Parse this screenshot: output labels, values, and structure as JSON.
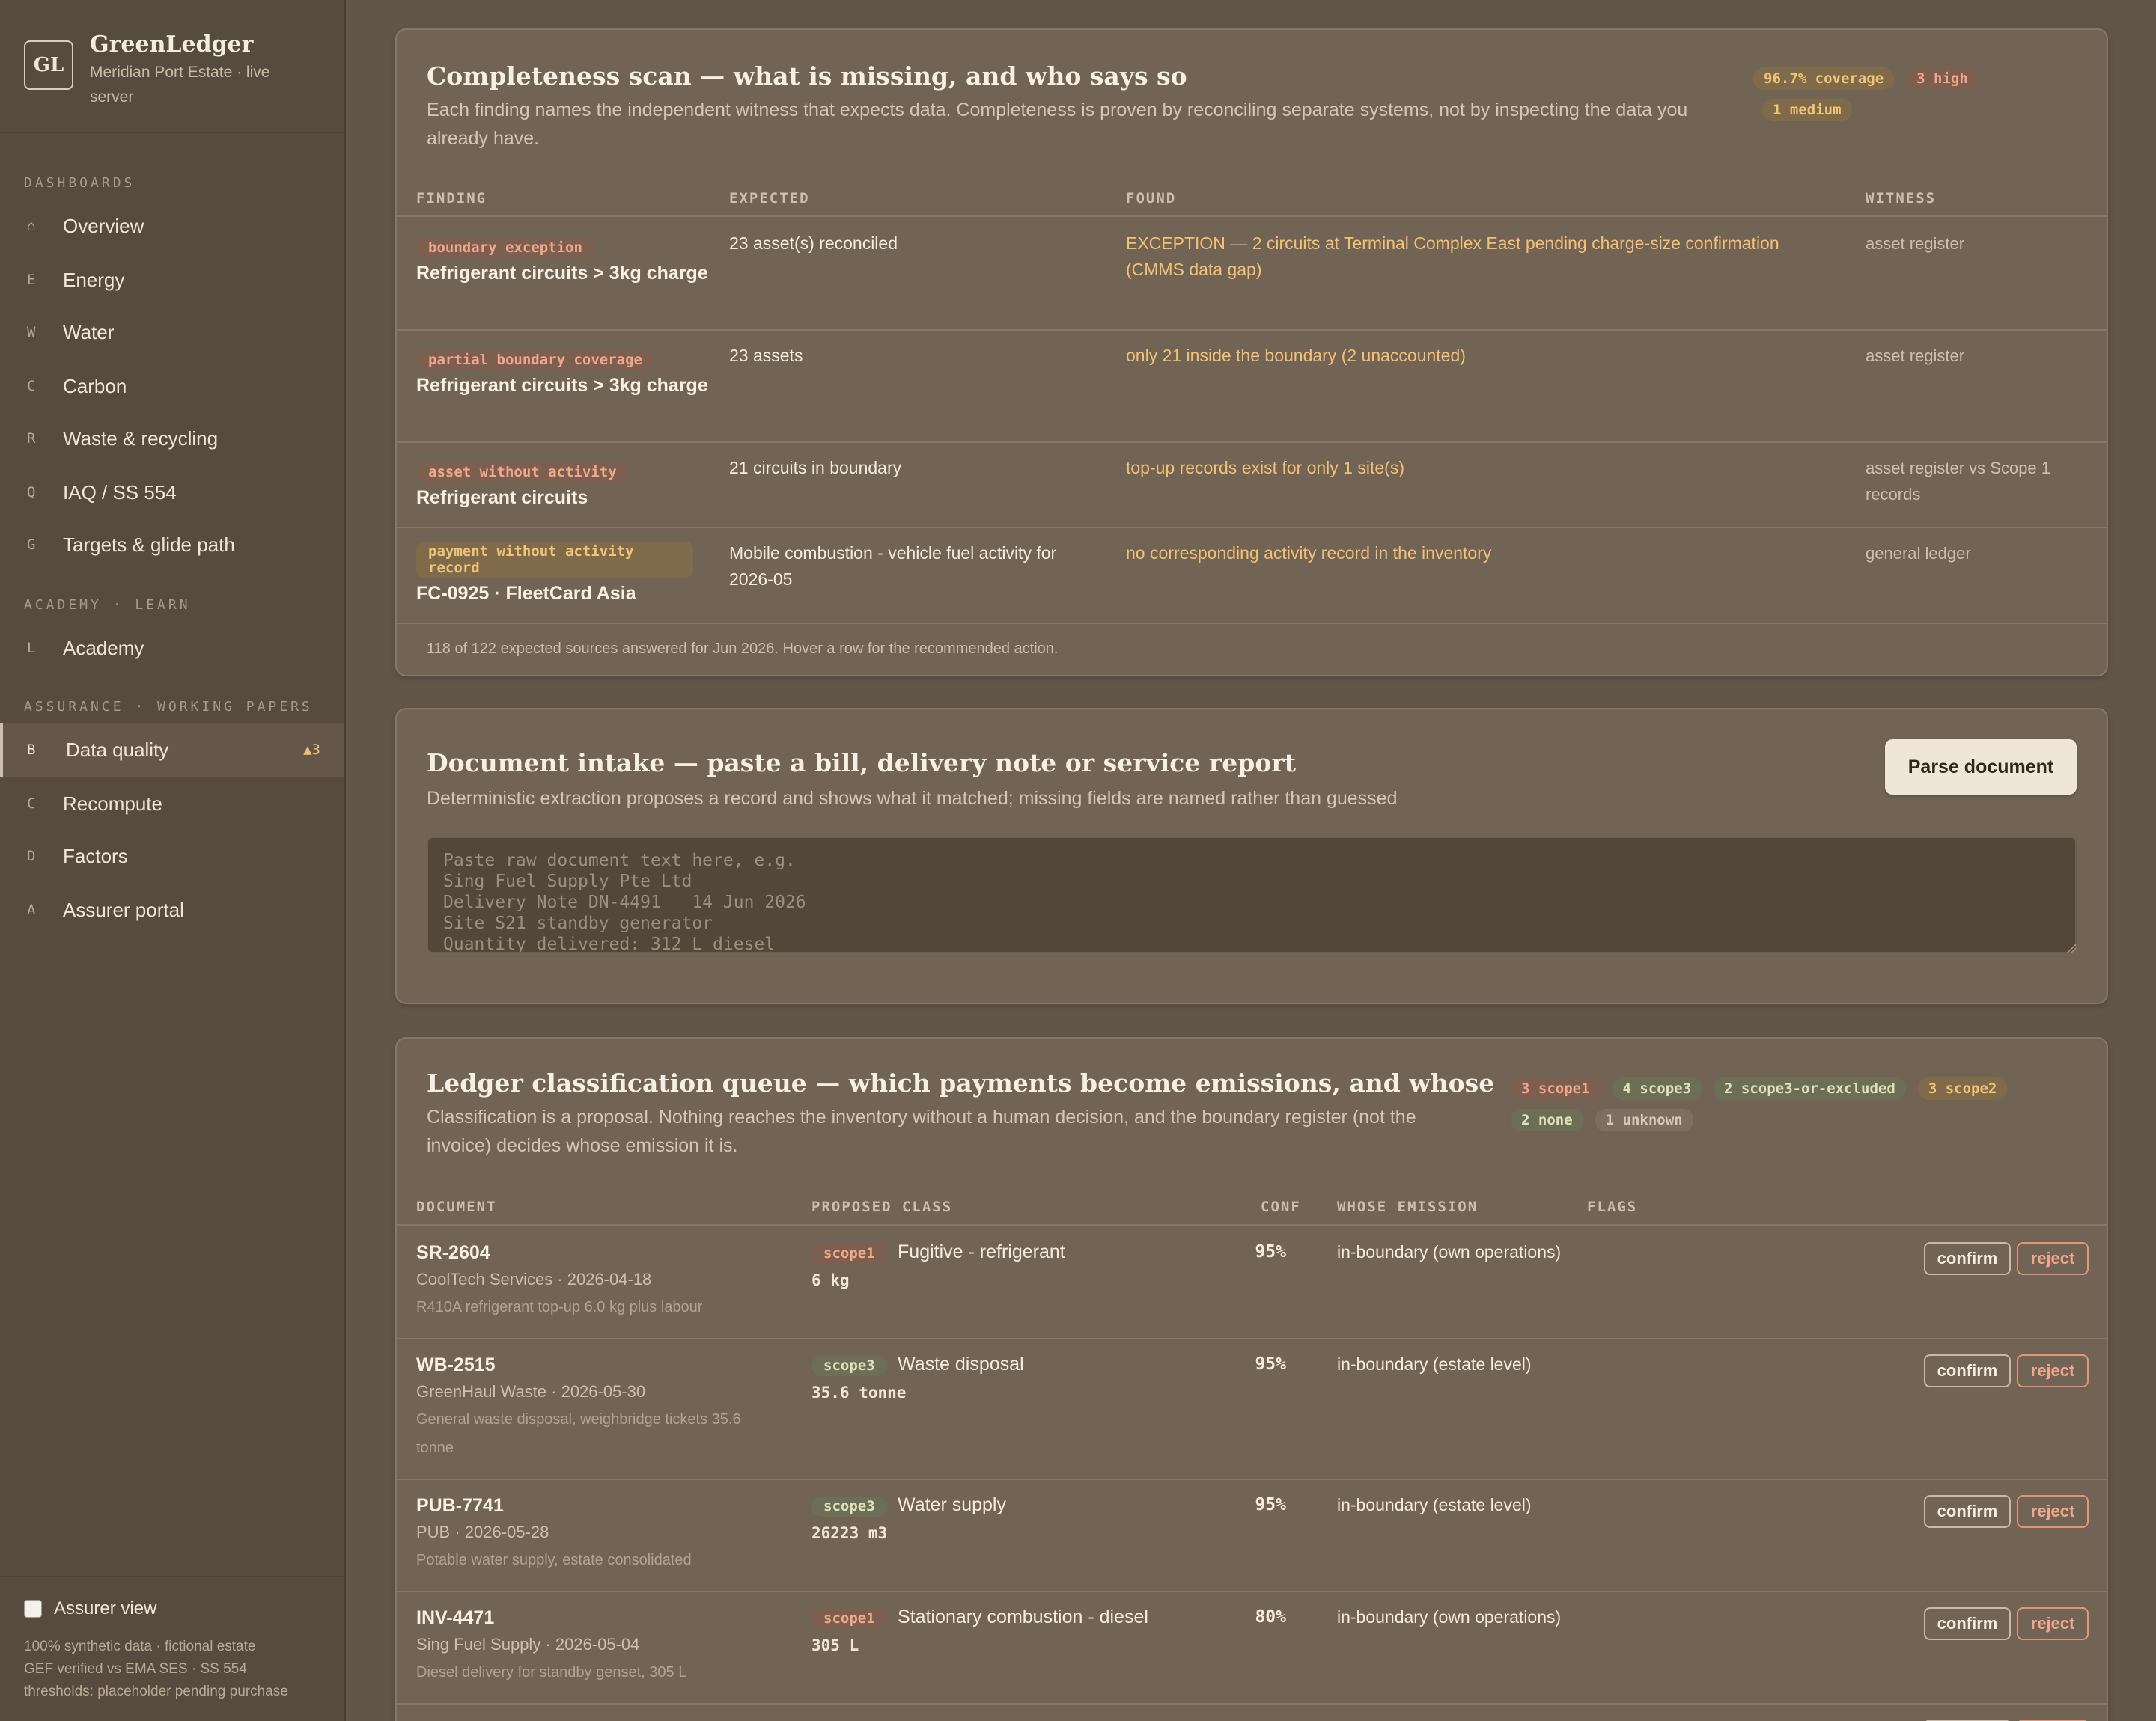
{
  "brand": {
    "logo": "GL",
    "name": "GreenLedger",
    "subtitle": "Meridian Port Estate · live server"
  },
  "sidebar": {
    "sections": [
      {
        "title": "DASHBOARDS",
        "items": [
          {
            "key": "⌂",
            "label": "Overview"
          },
          {
            "key": "E",
            "label": "Energy"
          },
          {
            "key": "W",
            "label": "Water"
          },
          {
            "key": "C",
            "label": "Carbon"
          },
          {
            "key": "R",
            "label": "Waste & recycling"
          },
          {
            "key": "Q",
            "label": "IAQ / SS 554"
          },
          {
            "key": "G",
            "label": "Targets & glide path"
          }
        ]
      },
      {
        "title": "ACADEMY · LEARN",
        "items": [
          {
            "key": "L",
            "label": "Academy"
          }
        ]
      },
      {
        "title": "ASSURANCE · WORKING PAPERS",
        "items": [
          {
            "key": "B",
            "label": "Data quality",
            "badge": "▲3",
            "active": true
          },
          {
            "key": "C",
            "label": "Recompute"
          },
          {
            "key": "D",
            "label": "Factors"
          },
          {
            "key": "A",
            "label": "Assurer portal"
          }
        ]
      }
    ],
    "assurer_label": "Assurer view",
    "footer_lines": [
      "100% synthetic data · fictional estate",
      "GEF verified vs EMA SES · SS 554",
      "thresholds: placeholder pending purchase"
    ]
  },
  "completeness": {
    "title": "Completeness scan — what is missing, and who says so",
    "description": "Each finding names the independent witness that expects data. Completeness is proven by reconciling separate systems, not by inspecting the data you already have.",
    "tags": [
      {
        "text": "96.7% coverage",
        "tone": "amber"
      },
      {
        "text": "3 high",
        "tone": "red"
      },
      {
        "text": "1 medium",
        "tone": "amber"
      }
    ],
    "columns": [
      "FINDING",
      "EXPECTED",
      "FOUND",
      "WITNESS"
    ],
    "rows": [
      {
        "tag": "boundary exception",
        "tone": "red",
        "subject": "Refrigerant circuits > 3kg charge",
        "expected": "23 asset(s) reconciled",
        "found": "EXCEPTION — 2 circuits at Terminal Complex East pending charge-size confirmation (CMMS data gap)",
        "witness": "asset register"
      },
      {
        "tag": "partial boundary coverage",
        "tone": "red",
        "subject": "Refrigerant circuits > 3kg charge",
        "expected": "23 assets",
        "found": "only 21 inside the boundary (2 unaccounted)",
        "witness": "asset register"
      },
      {
        "tag": "asset without activity",
        "tone": "red",
        "subject": "Refrigerant circuits",
        "expected": "21 circuits in boundary",
        "found": "top-up records exist for only 1 site(s)",
        "witness": "asset register vs Scope 1 records"
      },
      {
        "tag": "payment without activity record",
        "tone": "amber",
        "subject": "FC-0925 · FleetCard Asia",
        "expected": "Mobile combustion - vehicle fuel activity for 2026-05",
        "found": "no corresponding activity record in the inventory",
        "witness": "general ledger"
      }
    ],
    "footer": "118 of 122 expected sources answered for Jun 2026. Hover a row for the recommended action."
  },
  "intake": {
    "title": "Document intake — paste a bill, delivery note or service report",
    "description": "Deterministic extraction proposes a record and shows what it matched; missing fields are named rather than guessed",
    "button": "Parse document",
    "placeholder": "Paste raw document text here, e.g.\nSing Fuel Supply Pte Ltd\nDelivery Note DN-4491   14 Jun 2026\nSite S21 standby generator\nQuantity delivered: 312 L diesel"
  },
  "ledger": {
    "title": "Ledger classification queue — which payments become emissions, and whose",
    "description": "Classification is a proposal. Nothing reaches the inventory without a human decision, and the boundary register (not the invoice) decides whose emission it is.",
    "tags": [
      {
        "text": "3 scope1",
        "tone": "red"
      },
      {
        "text": "4 scope3",
        "tone": "green"
      },
      {
        "text": "2 scope3-or-excluded",
        "tone": "green"
      },
      {
        "text": "3 scope2",
        "tone": "amber"
      },
      {
        "text": "2 none",
        "tone": "green"
      },
      {
        "text": "1 unknown",
        "tone": "grey"
      }
    ],
    "columns": [
      "DOCUMENT",
      "PROPOSED CLASS",
      "CONF",
      "WHOSE EMISSION",
      "FLAGS"
    ],
    "confirm_label": "confirm",
    "reject_label": "reject",
    "rows": [
      {
        "doc": "SR-2604",
        "vendor": "CoolTech Services · 2026-04-18",
        "note": "R410A refrigerant top-up 6.0 kg plus labour",
        "scope": "scope1",
        "tone": "red",
        "class": "Fugitive - refrigerant",
        "qty": "6 kg",
        "conf": "95%",
        "whose": "in-boundary (own operations)"
      },
      {
        "doc": "WB-2515",
        "vendor": "GreenHaul Waste · 2026-05-30",
        "note": "General waste disposal, weighbridge tickets 35.6 tonne",
        "scope": "scope3",
        "tone": "green",
        "class": "Waste disposal",
        "qty": "35.6 tonne",
        "conf": "95%",
        "whose": "in-boundary (estate level)"
      },
      {
        "doc": "PUB-7741",
        "vendor": "PUB · 2026-05-28",
        "note": "Potable water supply, estate consolidated",
        "scope": "scope3",
        "tone": "green",
        "class": "Water supply",
        "qty": "26223 m3",
        "conf": "95%",
        "whose": "in-boundary (estate level)"
      },
      {
        "doc": "INV-4471",
        "vendor": "Sing Fuel Supply · 2026-05-04",
        "note": "Diesel delivery for standby genset, 305 L",
        "scope": "scope1",
        "tone": "red",
        "class": "Stationary combustion - diesel",
        "qty": "305 L",
        "conf": "80%",
        "whose": "in-boundary (own operations)"
      }
    ]
  }
}
